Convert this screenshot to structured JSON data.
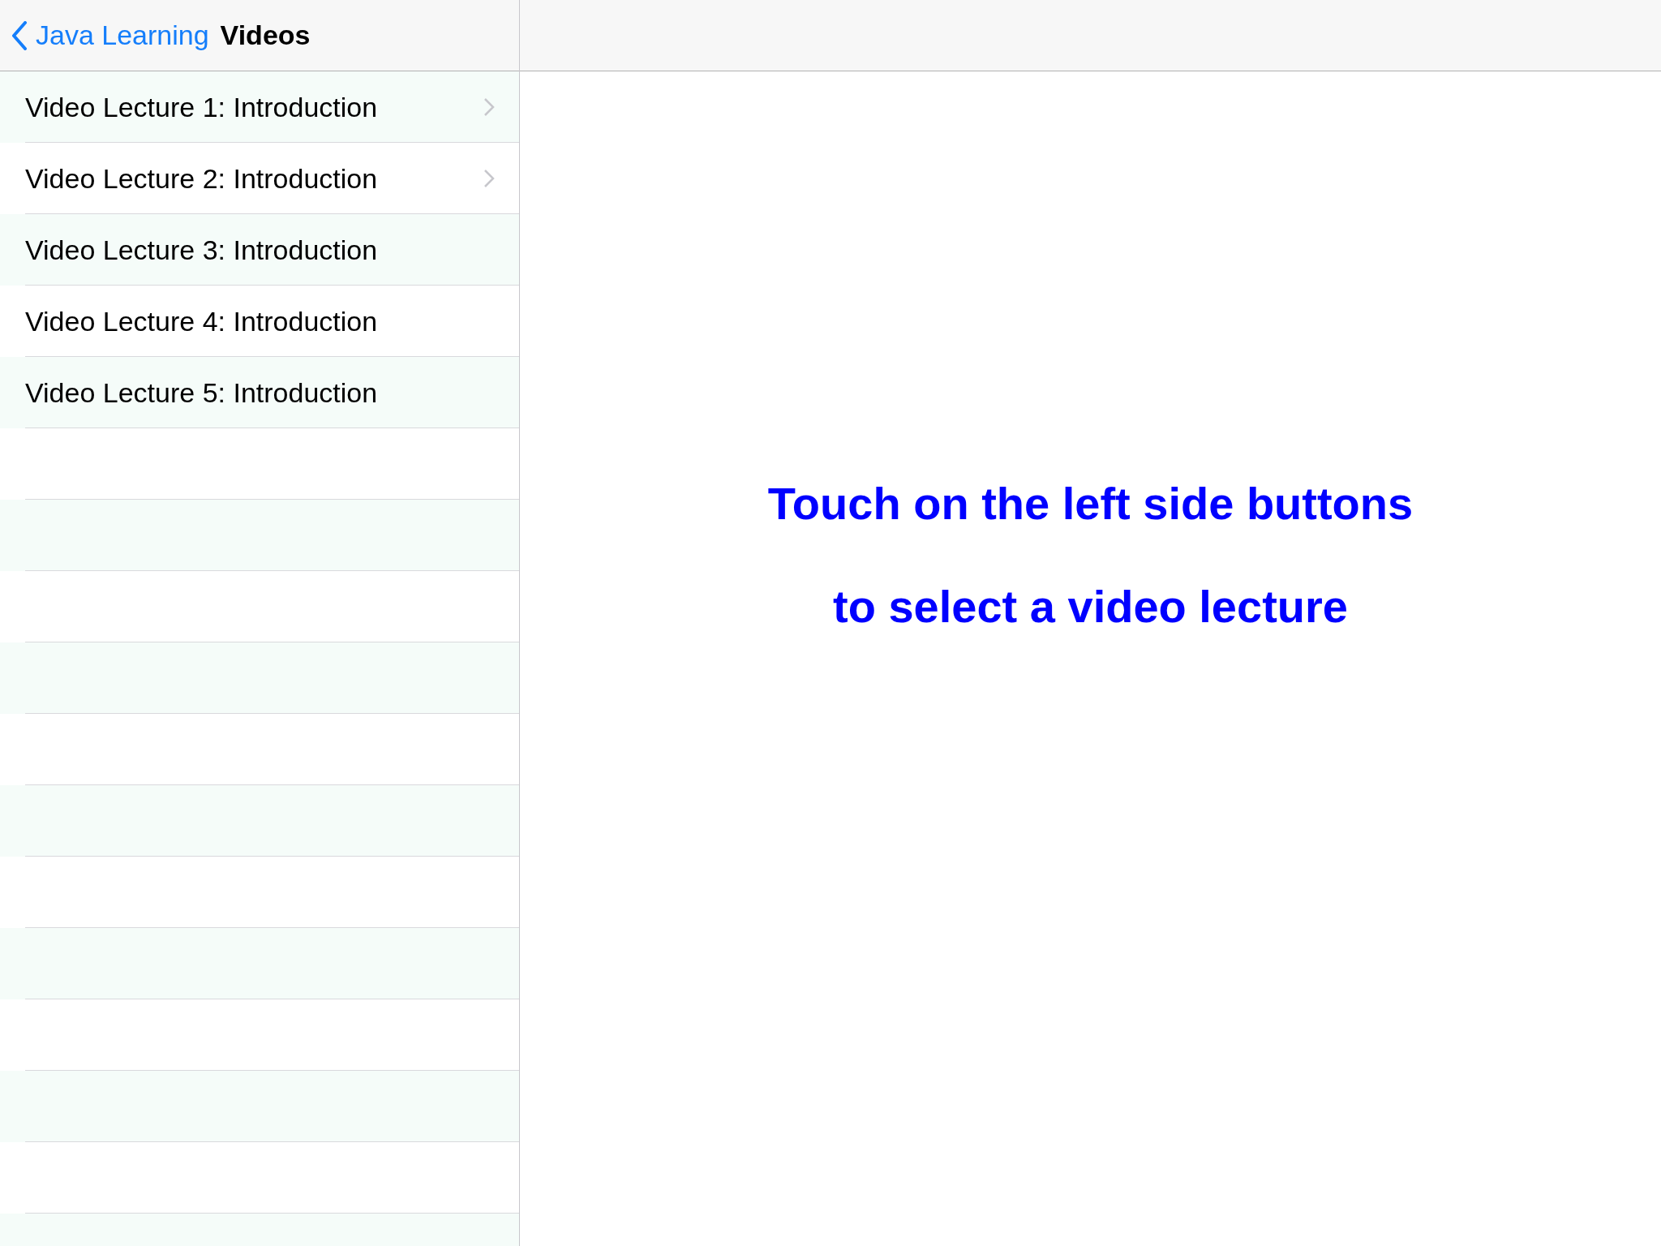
{
  "nav": {
    "back_label": "Java Learning",
    "title": "Videos"
  },
  "lectures": [
    {
      "title": "Video Lecture 1: Introduction",
      "disclosure": true
    },
    {
      "title": "Video Lecture 2: Introduction",
      "disclosure": true
    },
    {
      "title": "Video Lecture 3: Introduction",
      "disclosure": false
    },
    {
      "title": "Video Lecture 4: Introduction",
      "disclosure": false
    },
    {
      "title": "Video Lecture 5: Introduction",
      "disclosure": false
    }
  ],
  "detail": {
    "lines": [
      "Touch on the left side buttons",
      "to select a video lecture"
    ]
  }
}
